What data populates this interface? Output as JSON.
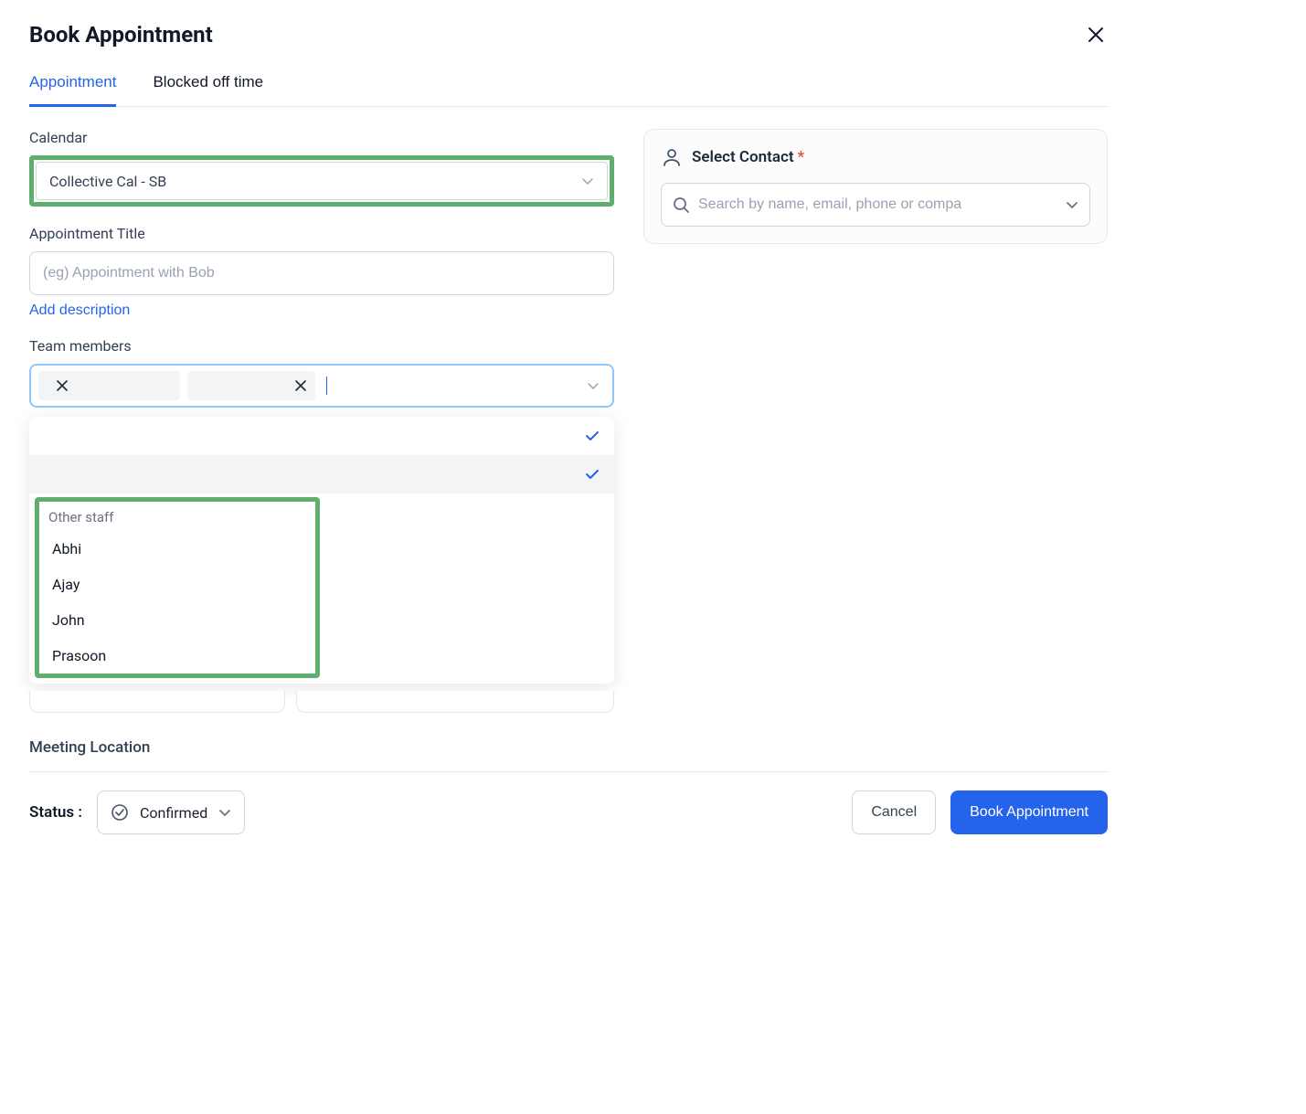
{
  "header": {
    "title": "Book Appointment"
  },
  "tabs": {
    "appointment": "Appointment",
    "blocked": "Blocked off time"
  },
  "left": {
    "calendar_label": "Calendar",
    "calendar_value": "Collective Cal - SB",
    "appt_title_label": "Appointment Title",
    "appt_title_placeholder": "(eg) Appointment with Bob",
    "add_description": "Add description",
    "team_label": "Team members",
    "other_staff_header": "Other staff",
    "staff": {
      "a": "Abhi",
      "b": "Ajay",
      "c": "John",
      "d": "Prasoon"
    },
    "meeting_location": "Meeting Location"
  },
  "contact": {
    "label": "Select Contact",
    "search_placeholder": "Search by name, email, phone or compa"
  },
  "footer": {
    "status_label": "Status :",
    "status_value": "Confirmed",
    "cancel": "Cancel",
    "book": "Book Appointment"
  }
}
